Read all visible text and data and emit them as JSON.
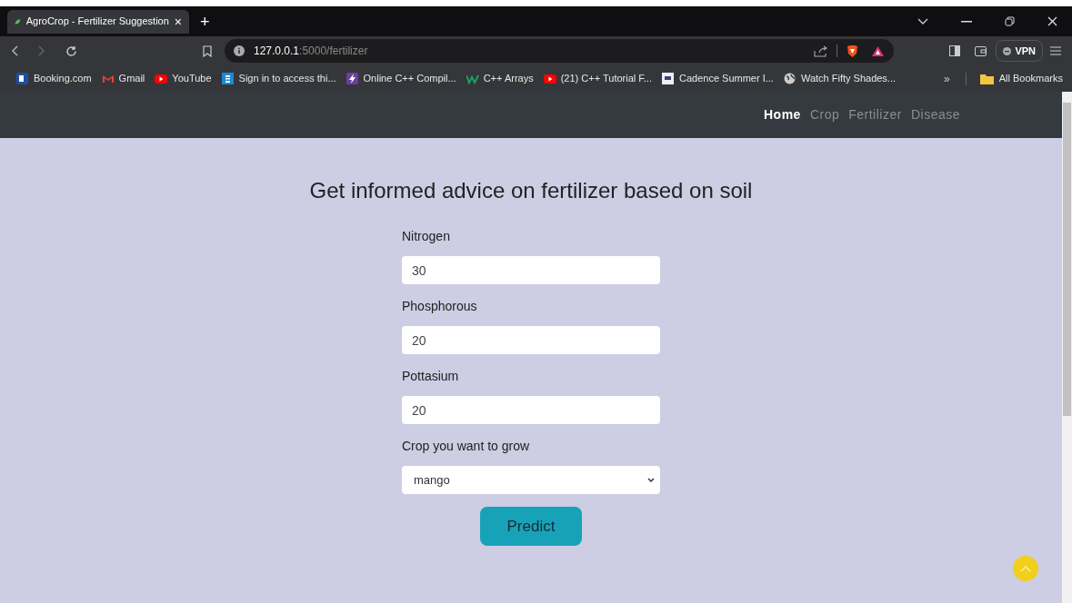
{
  "browser": {
    "tab": {
      "title": "AgroCrop - Fertilizer Suggestion",
      "close": "×"
    },
    "new_tab": "+",
    "address": {
      "host": "127.0.0.1",
      "path": ":5000/fertilizer"
    },
    "vpn": "VPN",
    "bookmarks": [
      {
        "kind": "booking",
        "label": "Booking.com"
      },
      {
        "kind": "gmail",
        "label": "Gmail"
      },
      {
        "kind": "youtube",
        "label": "YouTube"
      },
      {
        "kind": "s",
        "label": "Sign in to access thi..."
      },
      {
        "kind": "bolt",
        "label": "Online C++ Compil..."
      },
      {
        "kind": "w",
        "label": "C++ Arrays"
      },
      {
        "kind": "youtube",
        "label": "(21) C++ Tutorial F..."
      },
      {
        "kind": "doc",
        "label": "Cadence Summer I..."
      },
      {
        "kind": "globe",
        "label": "Watch Fifty Shades..."
      }
    ],
    "more": "»",
    "all_bookmarks": "All Bookmarks"
  },
  "navbar": {
    "items": [
      {
        "label": "Home",
        "selected": true
      },
      {
        "label": "Crop",
        "selected": false
      },
      {
        "label": "Fertilizer",
        "selected": false
      },
      {
        "label": "Disease",
        "selected": false
      }
    ]
  },
  "heading": "Get informed advice on fertilizer based on soil",
  "form": {
    "fields": [
      {
        "label": "Nitrogen",
        "value": "30"
      },
      {
        "label": "Phosphorous",
        "value": "20"
      },
      {
        "label": "Pottasium",
        "value": "20"
      }
    ],
    "select": {
      "label": "Crop you want to grow",
      "value": "mango"
    },
    "button": "Predict"
  }
}
